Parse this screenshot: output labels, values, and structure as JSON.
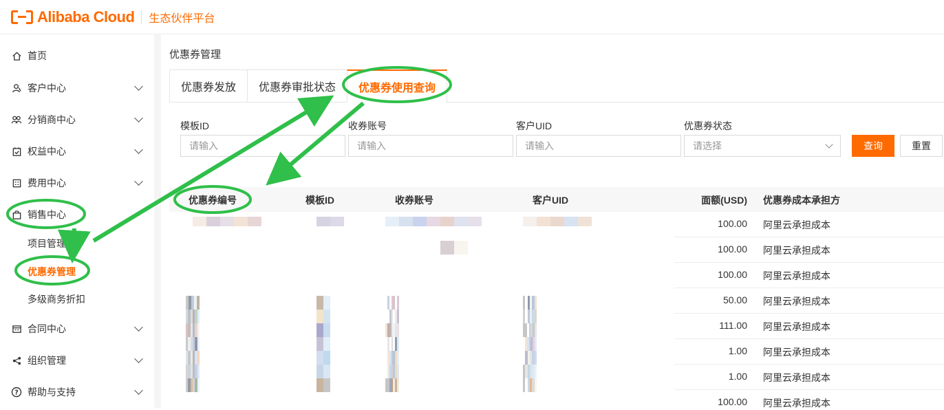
{
  "header": {
    "brand": "Alibaba Cloud",
    "subtitle": "生态伙伴平台"
  },
  "sidebar": {
    "items": [
      {
        "label": "首页",
        "icon": "home-icon"
      },
      {
        "label": "客户中心",
        "icon": "customer-icon"
      },
      {
        "label": "分销商中心",
        "icon": "team-icon"
      },
      {
        "label": "权益中心",
        "icon": "benefit-icon"
      },
      {
        "label": "费用中心",
        "icon": "billing-icon"
      },
      {
        "label": "销售中心",
        "icon": "bag-icon"
      },
      {
        "label": "合同中心",
        "icon": "contract-icon"
      },
      {
        "label": "组织管理",
        "icon": "share-icon"
      },
      {
        "label": "帮助与支持",
        "icon": "help-icon"
      }
    ],
    "sales_sub": [
      "项目管理",
      "优惠券管理",
      "多级商务折扣"
    ]
  },
  "page": {
    "title": "优惠券管理",
    "tabs": [
      "优惠券发放",
      "优惠券审批状态",
      "优惠券使用查询"
    ],
    "active_tab": "优惠券使用查询"
  },
  "filters": {
    "template_id": {
      "label": "模板ID",
      "placeholder": "请输入"
    },
    "receive_account": {
      "label": "收券账号",
      "placeholder": "请输入"
    },
    "customer_uid": {
      "label": "客户UID",
      "placeholder": "请输入"
    },
    "status": {
      "label": "优惠券状态",
      "placeholder": "请选择"
    },
    "query_label": "查询",
    "reset_label": "重置"
  },
  "table": {
    "columns": [
      "优惠券编号",
      "模板ID",
      "收券账号",
      "客户UID",
      "面额(USD)",
      "优惠券成本承担方"
    ],
    "rows": [
      {
        "amount": "100.00",
        "bearer": "阿里云承担成本"
      },
      {
        "amount": "100.00",
        "bearer": "阿里云承担成本"
      },
      {
        "amount": "100.00",
        "bearer": "阿里云承担成本"
      },
      {
        "amount": "50.00",
        "bearer": "阿里云承担成本"
      },
      {
        "amount": "111.00",
        "bearer": "阿里云承担成本"
      },
      {
        "amount": "1.00",
        "bearer": "阿里云承担成本"
      },
      {
        "amount": "1.00",
        "bearer": "阿里云承担成本"
      },
      {
        "amount": "100.00",
        "bearer": "阿里云承担成本"
      }
    ]
  },
  "colors": {
    "accent": "#ff6a00",
    "annotation": "#2fbf4a"
  }
}
